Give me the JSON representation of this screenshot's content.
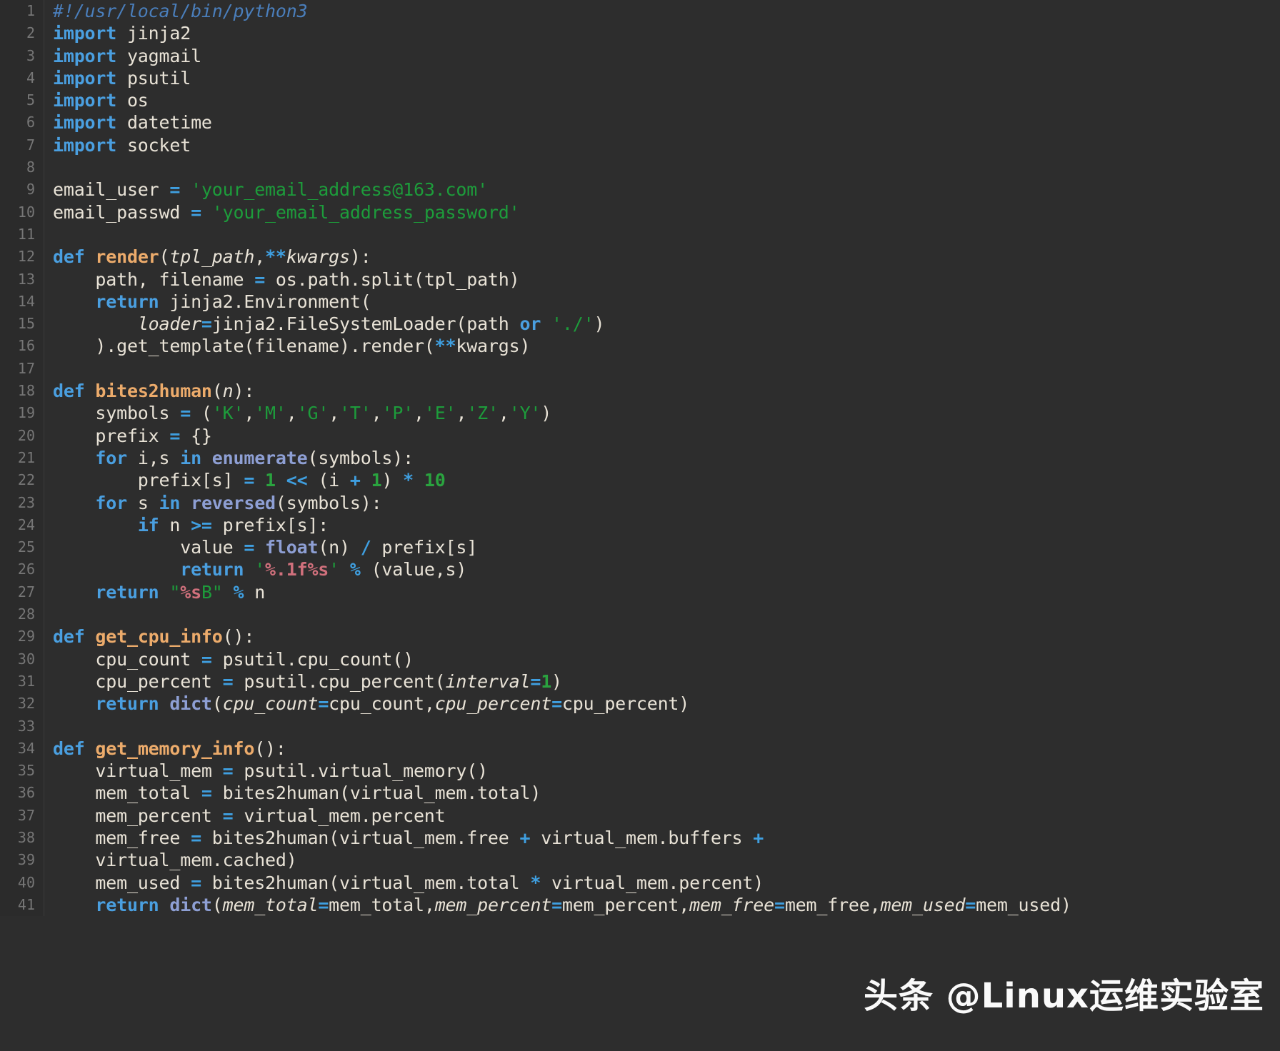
{
  "editor": {
    "language": "python",
    "theme": "dark",
    "background_color": "#2d2d2d",
    "gutter_color": "#2b2b2b",
    "line_number_color": "#767676",
    "default_text_color": "#e8e2d6",
    "total_lines": 41,
    "first_visible_line": 1,
    "last_visible_line": 41
  },
  "palette": {
    "comment": "#4a7ebb",
    "keyword": "#4a9fe0",
    "function_name": "#ecab6b",
    "builtin": "#8e9fd4",
    "string": "#1d9c3b",
    "number": "#2aa33f",
    "operator": "#3f9fe0",
    "format_spec": "#d0707c",
    "plain": "#e8e2d6"
  },
  "watermark": {
    "text": "头条 @Linux运维实验室"
  },
  "lines": [
    {
      "n": "1",
      "tokens": [
        {
          "t": "comment",
          "v": "#!/usr/local/bin/python3"
        }
      ]
    },
    {
      "n": "2",
      "tokens": [
        {
          "t": "kw",
          "v": "import"
        },
        {
          "t": "plain",
          "v": " jinja2"
        }
      ]
    },
    {
      "n": "3",
      "tokens": [
        {
          "t": "kw",
          "v": "import"
        },
        {
          "t": "plain",
          "v": " yagmail"
        }
      ]
    },
    {
      "n": "4",
      "tokens": [
        {
          "t": "kw",
          "v": "import"
        },
        {
          "t": "plain",
          "v": " psutil"
        }
      ]
    },
    {
      "n": "5",
      "tokens": [
        {
          "t": "kw",
          "v": "import"
        },
        {
          "t": "plain",
          "v": " os"
        }
      ]
    },
    {
      "n": "6",
      "tokens": [
        {
          "t": "kw",
          "v": "import"
        },
        {
          "t": "plain",
          "v": " datetime"
        }
      ]
    },
    {
      "n": "7",
      "tokens": [
        {
          "t": "kw",
          "v": "import"
        },
        {
          "t": "plain",
          "v": " socket"
        }
      ]
    },
    {
      "n": "8",
      "tokens": []
    },
    {
      "n": "9",
      "tokens": [
        {
          "t": "plain",
          "v": "email_user "
        },
        {
          "t": "op",
          "v": "="
        },
        {
          "t": "plain",
          "v": " "
        },
        {
          "t": "str",
          "v": "'your_email_address@163.com'"
        }
      ]
    },
    {
      "n": "10",
      "tokens": [
        {
          "t": "plain",
          "v": "email_passwd "
        },
        {
          "t": "op",
          "v": "="
        },
        {
          "t": "plain",
          "v": " "
        },
        {
          "t": "str",
          "v": "'your_email_address_password'"
        }
      ]
    },
    {
      "n": "11",
      "tokens": []
    },
    {
      "n": "12",
      "tokens": [
        {
          "t": "kw",
          "v": "def"
        },
        {
          "t": "plain",
          "v": " "
        },
        {
          "t": "fn",
          "v": "render"
        },
        {
          "t": "plain",
          "v": "("
        },
        {
          "t": "param",
          "v": "tpl_path"
        },
        {
          "t": "plain",
          "v": ","
        },
        {
          "t": "op",
          "v": "**"
        },
        {
          "t": "param",
          "v": "kwargs"
        },
        {
          "t": "plain",
          "v": "):"
        }
      ]
    },
    {
      "n": "13",
      "tokens": [
        {
          "t": "plain",
          "v": "    path, filename "
        },
        {
          "t": "op",
          "v": "="
        },
        {
          "t": "plain",
          "v": " os.path.split(tpl_path)"
        }
      ]
    },
    {
      "n": "14",
      "tokens": [
        {
          "t": "plain",
          "v": "    "
        },
        {
          "t": "kw",
          "v": "return"
        },
        {
          "t": "plain",
          "v": " jinja2.Environment("
        }
      ]
    },
    {
      "n": "15",
      "tokens": [
        {
          "t": "plain",
          "v": "        "
        },
        {
          "t": "param",
          "v": "loader"
        },
        {
          "t": "op",
          "v": "="
        },
        {
          "t": "plain",
          "v": "jinja2.FileSystemLoader(path "
        },
        {
          "t": "kw",
          "v": "or"
        },
        {
          "t": "plain",
          "v": " "
        },
        {
          "t": "str",
          "v": "'./'"
        },
        {
          "t": "plain",
          "v": ")"
        }
      ]
    },
    {
      "n": "16",
      "tokens": [
        {
          "t": "plain",
          "v": "    ).get_template(filename).render("
        },
        {
          "t": "op",
          "v": "**"
        },
        {
          "t": "plain",
          "v": "kwargs)"
        }
      ]
    },
    {
      "n": "17",
      "tokens": []
    },
    {
      "n": "18",
      "tokens": [
        {
          "t": "kw",
          "v": "def"
        },
        {
          "t": "plain",
          "v": " "
        },
        {
          "t": "fn",
          "v": "bites2human"
        },
        {
          "t": "plain",
          "v": "("
        },
        {
          "t": "param",
          "v": "n"
        },
        {
          "t": "plain",
          "v": "):"
        }
      ]
    },
    {
      "n": "19",
      "tokens": [
        {
          "t": "plain",
          "v": "    symbols "
        },
        {
          "t": "op",
          "v": "="
        },
        {
          "t": "plain",
          "v": " ("
        },
        {
          "t": "str",
          "v": "'K'"
        },
        {
          "t": "plain",
          "v": ","
        },
        {
          "t": "str",
          "v": "'M'"
        },
        {
          "t": "plain",
          "v": ","
        },
        {
          "t": "str",
          "v": "'G'"
        },
        {
          "t": "plain",
          "v": ","
        },
        {
          "t": "str",
          "v": "'T'"
        },
        {
          "t": "plain",
          "v": ","
        },
        {
          "t": "str",
          "v": "'P'"
        },
        {
          "t": "plain",
          "v": ","
        },
        {
          "t": "str",
          "v": "'E'"
        },
        {
          "t": "plain",
          "v": ","
        },
        {
          "t": "str",
          "v": "'Z'"
        },
        {
          "t": "plain",
          "v": ","
        },
        {
          "t": "str",
          "v": "'Y'"
        },
        {
          "t": "plain",
          "v": ")"
        }
      ]
    },
    {
      "n": "20",
      "tokens": [
        {
          "t": "plain",
          "v": "    prefix "
        },
        {
          "t": "op",
          "v": "="
        },
        {
          "t": "plain",
          "v": " {}"
        }
      ]
    },
    {
      "n": "21",
      "tokens": [
        {
          "t": "plain",
          "v": "    "
        },
        {
          "t": "kw",
          "v": "for"
        },
        {
          "t": "plain",
          "v": " i,s "
        },
        {
          "t": "kw",
          "v": "in"
        },
        {
          "t": "plain",
          "v": " "
        },
        {
          "t": "builtin",
          "v": "enumerate"
        },
        {
          "t": "plain",
          "v": "(symbols):"
        }
      ]
    },
    {
      "n": "22",
      "tokens": [
        {
          "t": "plain",
          "v": "        prefix[s] "
        },
        {
          "t": "op",
          "v": "="
        },
        {
          "t": "plain",
          "v": " "
        },
        {
          "t": "num",
          "v": "1"
        },
        {
          "t": "plain",
          "v": " "
        },
        {
          "t": "op",
          "v": "<<"
        },
        {
          "t": "plain",
          "v": " (i "
        },
        {
          "t": "op",
          "v": "+"
        },
        {
          "t": "plain",
          "v": " "
        },
        {
          "t": "num",
          "v": "1"
        },
        {
          "t": "plain",
          "v": ") "
        },
        {
          "t": "op",
          "v": "*"
        },
        {
          "t": "plain",
          "v": " "
        },
        {
          "t": "num",
          "v": "10"
        }
      ]
    },
    {
      "n": "23",
      "tokens": [
        {
          "t": "plain",
          "v": "    "
        },
        {
          "t": "kw",
          "v": "for"
        },
        {
          "t": "plain",
          "v": " s "
        },
        {
          "t": "kw",
          "v": "in"
        },
        {
          "t": "plain",
          "v": " "
        },
        {
          "t": "builtin",
          "v": "reversed"
        },
        {
          "t": "plain",
          "v": "(symbols):"
        }
      ]
    },
    {
      "n": "24",
      "tokens": [
        {
          "t": "plain",
          "v": "        "
        },
        {
          "t": "kw",
          "v": "if"
        },
        {
          "t": "plain",
          "v": " n "
        },
        {
          "t": "op",
          "v": ">="
        },
        {
          "t": "plain",
          "v": " prefix[s]:"
        }
      ]
    },
    {
      "n": "25",
      "tokens": [
        {
          "t": "plain",
          "v": "            value "
        },
        {
          "t": "op",
          "v": "="
        },
        {
          "t": "plain",
          "v": " "
        },
        {
          "t": "builtin",
          "v": "float"
        },
        {
          "t": "plain",
          "v": "(n) "
        },
        {
          "t": "op",
          "v": "/"
        },
        {
          "t": "plain",
          "v": " prefix[s]"
        }
      ]
    },
    {
      "n": "26",
      "tokens": [
        {
          "t": "plain",
          "v": "            "
        },
        {
          "t": "kw",
          "v": "return"
        },
        {
          "t": "plain",
          "v": " "
        },
        {
          "t": "str",
          "v": "'"
        },
        {
          "t": "fmt",
          "v": "%.1f%s"
        },
        {
          "t": "str",
          "v": "'"
        },
        {
          "t": "plain",
          "v": " "
        },
        {
          "t": "op",
          "v": "%"
        },
        {
          "t": "plain",
          "v": " (value,s)"
        }
      ]
    },
    {
      "n": "27",
      "tokens": [
        {
          "t": "plain",
          "v": "    "
        },
        {
          "t": "kw",
          "v": "return"
        },
        {
          "t": "plain",
          "v": " "
        },
        {
          "t": "str",
          "v": "\""
        },
        {
          "t": "fmt",
          "v": "%s"
        },
        {
          "t": "str",
          "v": "B\""
        },
        {
          "t": "plain",
          "v": " "
        },
        {
          "t": "op",
          "v": "%"
        },
        {
          "t": "plain",
          "v": " n"
        }
      ]
    },
    {
      "n": "28",
      "tokens": []
    },
    {
      "n": "29",
      "tokens": [
        {
          "t": "kw",
          "v": "def"
        },
        {
          "t": "plain",
          "v": " "
        },
        {
          "t": "fn",
          "v": "get_cpu_info"
        },
        {
          "t": "plain",
          "v": "():"
        }
      ]
    },
    {
      "n": "30",
      "tokens": [
        {
          "t": "plain",
          "v": "    cpu_count "
        },
        {
          "t": "op",
          "v": "="
        },
        {
          "t": "plain",
          "v": " psutil.cpu_count()"
        }
      ]
    },
    {
      "n": "31",
      "tokens": [
        {
          "t": "plain",
          "v": "    cpu_percent "
        },
        {
          "t": "op",
          "v": "="
        },
        {
          "t": "plain",
          "v": " psutil.cpu_percent("
        },
        {
          "t": "param",
          "v": "interval"
        },
        {
          "t": "op",
          "v": "="
        },
        {
          "t": "num",
          "v": "1"
        },
        {
          "t": "plain",
          "v": ")"
        }
      ]
    },
    {
      "n": "32",
      "tokens": [
        {
          "t": "plain",
          "v": "    "
        },
        {
          "t": "kw",
          "v": "return"
        },
        {
          "t": "plain",
          "v": " "
        },
        {
          "t": "builtin",
          "v": "dict"
        },
        {
          "t": "plain",
          "v": "("
        },
        {
          "t": "param",
          "v": "cpu_count"
        },
        {
          "t": "op",
          "v": "="
        },
        {
          "t": "plain",
          "v": "cpu_count,"
        },
        {
          "t": "param",
          "v": "cpu_percent"
        },
        {
          "t": "op",
          "v": "="
        },
        {
          "t": "plain",
          "v": "cpu_percent)"
        }
      ]
    },
    {
      "n": "33",
      "tokens": []
    },
    {
      "n": "34",
      "tokens": [
        {
          "t": "kw",
          "v": "def"
        },
        {
          "t": "plain",
          "v": " "
        },
        {
          "t": "fn",
          "v": "get_memory_info"
        },
        {
          "t": "plain",
          "v": "():"
        }
      ]
    },
    {
      "n": "35",
      "tokens": [
        {
          "t": "plain",
          "v": "    virtual_mem "
        },
        {
          "t": "op",
          "v": "="
        },
        {
          "t": "plain",
          "v": " psutil.virtual_memory()"
        }
      ]
    },
    {
      "n": "36",
      "tokens": [
        {
          "t": "plain",
          "v": "    mem_total "
        },
        {
          "t": "op",
          "v": "="
        },
        {
          "t": "plain",
          "v": " bites2human(virtual_mem.total)"
        }
      ]
    },
    {
      "n": "37",
      "tokens": [
        {
          "t": "plain",
          "v": "    mem_percent "
        },
        {
          "t": "op",
          "v": "="
        },
        {
          "t": "plain",
          "v": " virtual_mem.percent"
        }
      ]
    },
    {
      "n": "38",
      "tokens": [
        {
          "t": "plain",
          "v": "    mem_free "
        },
        {
          "t": "op",
          "v": "="
        },
        {
          "t": "plain",
          "v": " bites2human(virtual_mem.free "
        },
        {
          "t": "op",
          "v": "+"
        },
        {
          "t": "plain",
          "v": " virtual_mem.buffers "
        },
        {
          "t": "op",
          "v": "+"
        }
      ]
    },
    {
      "n": "39",
      "tokens": [
        {
          "t": "plain",
          "v": "    virtual_mem.cached)"
        }
      ]
    },
    {
      "n": "40",
      "tokens": [
        {
          "t": "plain",
          "v": "    mem_used "
        },
        {
          "t": "op",
          "v": "="
        },
        {
          "t": "plain",
          "v": " bites2human(virtual_mem.total "
        },
        {
          "t": "op",
          "v": "*"
        },
        {
          "t": "plain",
          "v": " virtual_mem.percent)"
        }
      ]
    },
    {
      "n": "41",
      "tokens": [
        {
          "t": "plain",
          "v": "    "
        },
        {
          "t": "kw",
          "v": "return"
        },
        {
          "t": "plain",
          "v": " "
        },
        {
          "t": "builtin",
          "v": "dict"
        },
        {
          "t": "plain",
          "v": "("
        },
        {
          "t": "param",
          "v": "mem_total"
        },
        {
          "t": "op",
          "v": "="
        },
        {
          "t": "plain",
          "v": "mem_total,"
        },
        {
          "t": "param",
          "v": "mem_percent"
        },
        {
          "t": "op",
          "v": "="
        },
        {
          "t": "plain",
          "v": "mem_percent,"
        },
        {
          "t": "param",
          "v": "mem_free"
        },
        {
          "t": "op",
          "v": "="
        },
        {
          "t": "plain",
          "v": "mem_free,"
        },
        {
          "t": "param",
          "v": "mem_used"
        },
        {
          "t": "op",
          "v": "="
        },
        {
          "t": "plain",
          "v": "mem_used)"
        }
      ]
    }
  ]
}
